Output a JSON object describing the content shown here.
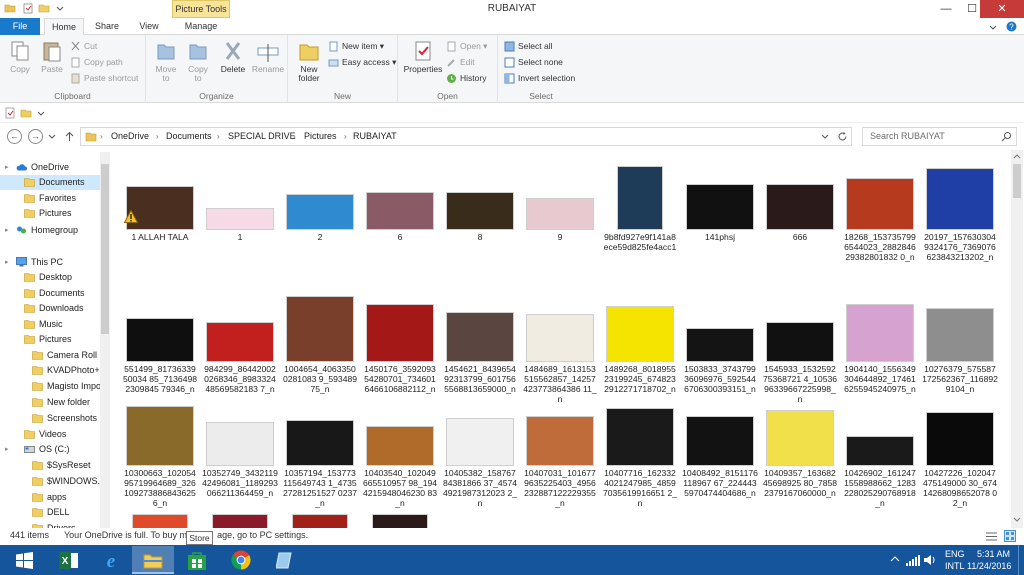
{
  "window": {
    "title": "RUBAIYAT",
    "context_tab": "Picture Tools",
    "minimize_glyph": "—",
    "maximize_glyph": "☐",
    "close_glyph": "✕"
  },
  "tabs": {
    "file": "File",
    "home": "Home",
    "share": "Share",
    "view": "View",
    "manage": "Manage"
  },
  "ribbon": {
    "clipboard": {
      "label": "Clipboard",
      "copy": "Copy",
      "paste": "Paste",
      "cut": "Cut",
      "copy_path": "Copy path",
      "paste_shortcut": "Paste shortcut"
    },
    "organize": {
      "label": "Organize",
      "move_to": "Move to",
      "copy_to": "Copy to",
      "delete": "Delete",
      "rename": "Rename"
    },
    "new": {
      "label": "New",
      "new_folder": "New folder",
      "new_item": "New item",
      "easy_access": "Easy access"
    },
    "open": {
      "label": "Open",
      "properties": "Properties",
      "open": "Open",
      "edit": "Edit",
      "history": "History"
    },
    "select": {
      "label": "Select",
      "select_all": "Select all",
      "select_none": "Select none",
      "invert_selection": "Invert selection"
    }
  },
  "address": {
    "crumbs": [
      "OneDrive",
      "Documents",
      "SPECIAL DRIVE",
      "Pictures",
      "RUBAIYAT"
    ],
    "search_placeholder": "Search RUBAIYAT"
  },
  "nav": [
    {
      "label": "OneDrive",
      "icon": "cloud-icon"
    },
    {
      "label": "Documents",
      "icon": "folder-icon"
    },
    {
      "label": "Favorites",
      "icon": "folder-icon"
    },
    {
      "label": "Pictures",
      "icon": "folder-icon"
    },
    {
      "label": "Homegroup",
      "icon": "homegroup-icon"
    },
    {
      "label": "This PC",
      "icon": "computer-icon"
    },
    {
      "label": "Desktop",
      "icon": "folder-icon"
    },
    {
      "label": "Documents",
      "icon": "folder-icon"
    },
    {
      "label": "Downloads",
      "icon": "folder-icon"
    },
    {
      "label": "Music",
      "icon": "folder-icon"
    },
    {
      "label": "Pictures",
      "icon": "folder-icon"
    },
    {
      "label": "Camera Roll",
      "icon": "folder-icon"
    },
    {
      "label": "KVADPhoto+",
      "icon": "folder-icon"
    },
    {
      "label": "Magisto Impo",
      "icon": "folder-icon"
    },
    {
      "label": "New folder",
      "icon": "folder-icon"
    },
    {
      "label": "Screenshots",
      "icon": "folder-icon"
    },
    {
      "label": "Videos",
      "icon": "folder-icon"
    },
    {
      "label": "OS (C:)",
      "icon": "drive-icon"
    },
    {
      "label": "$SysReset",
      "icon": "folder-icon"
    },
    {
      "label": "$WINDOWS.~",
      "icon": "folder-icon"
    },
    {
      "label": "apps",
      "icon": "folder-icon"
    },
    {
      "label": "DELL",
      "icon": "folder-icon"
    },
    {
      "label": "Drivers",
      "icon": "folder-icon"
    }
  ],
  "files": [
    {
      "name": "1 ALLAH TALA",
      "color": "#4a2e20"
    },
    {
      "name": "1",
      "color": "#f6dbe6"
    },
    {
      "name": "2",
      "color": "#2f8ad0"
    },
    {
      "name": "6",
      "color": "#8a5b66"
    },
    {
      "name": "8",
      "color": "#3a2c1a"
    },
    {
      "name": "9",
      "color": "#e8c9cf"
    },
    {
      "name": "9b8fd927e9f141a8ece59d825fe4acc1",
      "color": "#1e3b57"
    },
    {
      "name": "141phsj",
      "color": "#111111"
    },
    {
      "name": "666",
      "color": "#2a1a1a"
    },
    {
      "name": "18268_1537357996544023_288284629382801832 0_n",
      "color": "#b63a1d"
    },
    {
      "name": "20197_1576303049324176_7369076623843213202_n",
      "color": "#1f3fa6"
    },
    {
      "name": "551499_8173633950034 85_71364982309845 79346_n",
      "color": "#0f0f0f"
    },
    {
      "name": "984299_864420020268346_898332448569582183 7_n",
      "color": "#c21f1f"
    },
    {
      "name": "1004654_40633500281083 9_59348975_n",
      "color": "#7a3f2a"
    },
    {
      "name": "1450176_359209354280701_7346016466106882112_n",
      "color": "#a51818"
    },
    {
      "name": "1454621_843965492313799_6017565568813659000_n",
      "color": "#5a4540"
    },
    {
      "name": "1484689_1613153515562857_14257423773864386 11_n",
      "color": "#f0ece2"
    },
    {
      "name": "1489268_801895523199245_6748232912271718702_n",
      "color": "#f4e400"
    },
    {
      "name": "1503833_374379936096976_5925446706300393151_n",
      "color": "#141414"
    },
    {
      "name": "1545933_153259275368721 4_1053696339667225998_n",
      "color": "#111111"
    },
    {
      "name": "1904140_1556349304644892_174616255945240975_n",
      "color": "#d6a2d0"
    },
    {
      "name": "10276379_575587172562367_1168929104_n",
      "color": "#8e8e8e"
    },
    {
      "name": "10300663_10205495719964689_3261092738868436256_n",
      "color": "#8a6a2a"
    },
    {
      "name": "10352749_343211942496081_1189293066211364459_n",
      "color": "#ececec"
    },
    {
      "name": "10357194_153773115649743 1_473527281251527 0237_n",
      "color": "#181818"
    },
    {
      "name": "10403540_102049665510957 98_1944215948046230 83_n",
      "color": "#b06a2a"
    },
    {
      "name": "10405382_15876784381866 37_45744921987312023 2_n",
      "color": "#f0f0f0"
    },
    {
      "name": "10407031_1016779635225403_4956232887122229355_n",
      "color": "#c06b3a"
    },
    {
      "name": "10407716_1623324021247985_48597035619916651 2_n",
      "color": "#1a1a1a"
    },
    {
      "name": "10408492_8151176118967 67_2244435970474404686_n",
      "color": "#121212"
    },
    {
      "name": "10409357_16368245698925 80_78582379167060000_n",
      "color": "#f2e04a"
    },
    {
      "name": "10426902_1612471558988662_1283228025290768918_n",
      "color": "#1a1a1a"
    },
    {
      "name": "10427226_102047475149000 30_67414268098652078 02_n",
      "color": "#0a0a0a"
    },
    {
      "name": "",
      "color": "#e04a2a"
    },
    {
      "name": "",
      "color": "#8a1a2a"
    },
    {
      "name": "",
      "color": "#a0201a"
    },
    {
      "name": "",
      "color": "#2a1a1a"
    }
  ],
  "status": {
    "count": "441 items",
    "message": "Your OneDrive is full. To buy m",
    "message_tail": "age, go to PC settings.",
    "tooltip": "Store"
  },
  "taskbar": {
    "apps": [
      "windows-icon",
      "internet-explorer-icon",
      "file-explorer-icon",
      "store-icon",
      "chrome-icon",
      "app-icon"
    ],
    "language": "ENG",
    "keyboard": "INTL",
    "time": "5:31 AM",
    "date": "11/24/2016"
  }
}
